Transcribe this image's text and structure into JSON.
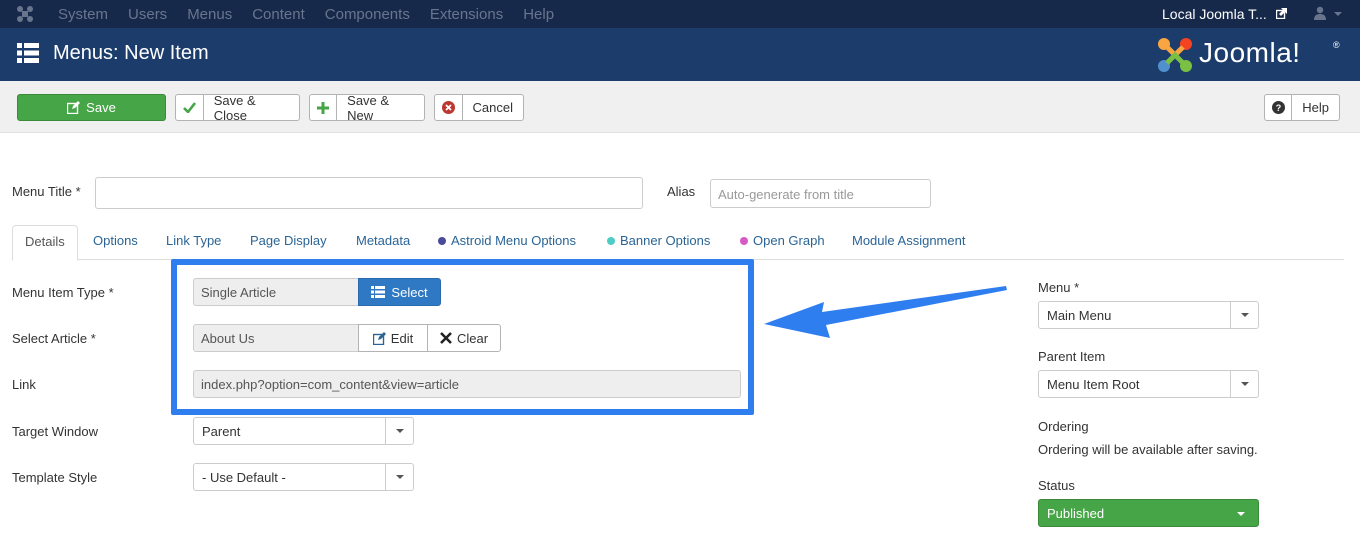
{
  "topbar": {
    "menu": [
      "System",
      "Users",
      "Menus",
      "Content",
      "Components",
      "Extensions",
      "Help"
    ],
    "site_name": "Local Joomla T..."
  },
  "header": {
    "title": "Menus: New Item",
    "brand": "Joomla!",
    "registered": "®"
  },
  "toolbar": {
    "save": "Save",
    "save_close": "Save & Close",
    "save_new": "Save & New",
    "cancel": "Cancel",
    "help": "Help"
  },
  "form": {
    "menu_title_label": "Menu Title *",
    "menu_title_value": "",
    "alias_label": "Alias",
    "alias_placeholder": "Auto-generate from title"
  },
  "tabs": [
    {
      "label": "Details"
    },
    {
      "label": "Options"
    },
    {
      "label": "Link Type"
    },
    {
      "label": "Page Display"
    },
    {
      "label": "Metadata"
    },
    {
      "label": "Astroid Menu Options",
      "dot": "#4a4a9a"
    },
    {
      "label": "Banner Options",
      "dot": "#4ecdc4"
    },
    {
      "label": "Open Graph",
      "dot": "#d65bc4"
    },
    {
      "label": "Module Assignment"
    }
  ],
  "details": {
    "menu_item_type_label": "Menu Item Type *",
    "menu_item_type_value": "Single Article",
    "select_button": "Select",
    "select_article_label": "Select Article *",
    "select_article_value": "About Us",
    "edit_button": "Edit",
    "clear_button": "Clear",
    "link_label": "Link",
    "link_value": "index.php?option=com_content&view=article",
    "target_window_label": "Target Window",
    "target_window_value": "Parent",
    "template_style_label": "Template Style",
    "template_style_value": "- Use Default -"
  },
  "sidebar": {
    "menu_label": "Menu *",
    "menu_value": "Main Menu",
    "parent_label": "Parent Item",
    "parent_value": "Menu Item Root",
    "ordering_label": "Ordering",
    "ordering_text": "Ordering will be available after saving.",
    "status_label": "Status",
    "status_value": "Published"
  },
  "colors": {
    "topbar": "#17294a",
    "header": "#1c3d6c",
    "save_green": "#46a546",
    "select_blue": "#2f78c4",
    "highlight": "#2f7ef0"
  }
}
